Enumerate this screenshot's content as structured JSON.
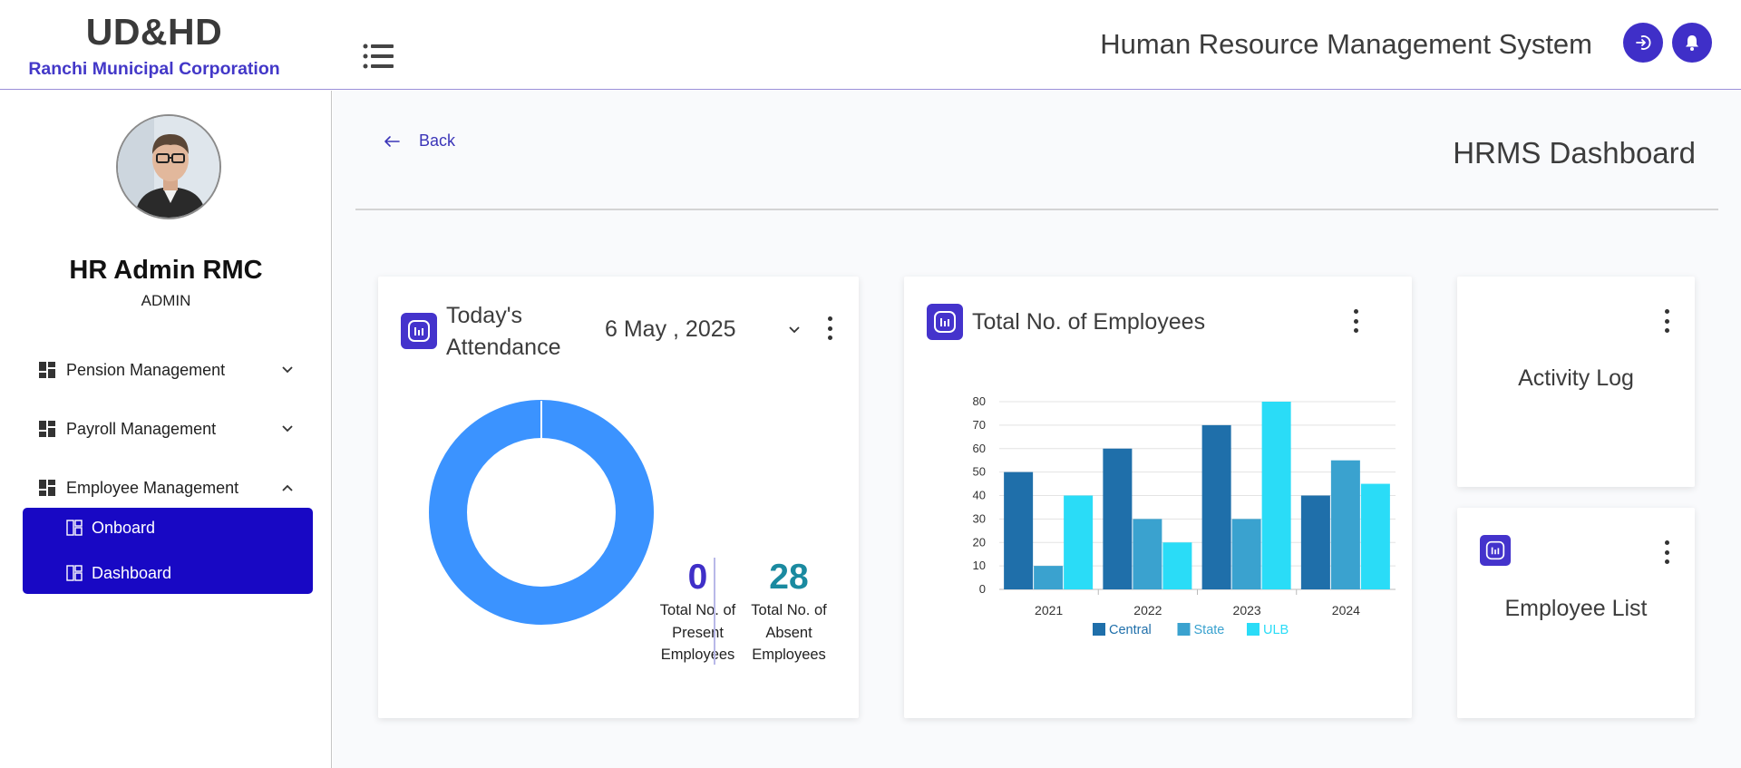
{
  "header": {
    "brand_title": "UD&HD",
    "brand_subtitle": "Ranchi Municipal Corporation",
    "app_title": "Human Resource Management System"
  },
  "sidebar": {
    "user_name": "HR Admin RMC",
    "user_role": "ADMIN",
    "items": [
      {
        "label": "Pension Management",
        "expanded": false
      },
      {
        "label": "Payroll Management",
        "expanded": false
      },
      {
        "label": "Employee Management",
        "expanded": true
      }
    ],
    "subitems": [
      {
        "label": "Onboard"
      },
      {
        "label": "Dashboard"
      }
    ]
  },
  "main": {
    "back_label": "Back",
    "page_title": "HRMS Dashboard",
    "attendance": {
      "title": "Today's Attendance",
      "date": "6 May , 2025",
      "present_count": "0",
      "present_label": "Total No. of Present Employees",
      "absent_count": "28",
      "absent_label": "Total No. of Absent Employees"
    },
    "employees": {
      "title": "Total No. of Employees"
    },
    "activity_log": {
      "title": "Activity Log"
    },
    "employee_list": {
      "title": "Employee List"
    }
  },
  "colors": {
    "accent": "#4433cc",
    "submenu_bg": "#1808c4",
    "brand_sub": "#4338c8",
    "present": "#3f2fc8",
    "absent": "#1a8aa0",
    "donut": "#3b93ff"
  },
  "chart_data": {
    "type": "bar",
    "categories": [
      "2021",
      "2022",
      "2023",
      "2024"
    ],
    "series": [
      {
        "name": "Central",
        "values": [
          50,
          60,
          70,
          40
        ],
        "color": "#1f6faa"
      },
      {
        "name": "State",
        "values": [
          10,
          30,
          30,
          55
        ],
        "color": "#3aa2cf"
      },
      {
        "name": "ULB",
        "values": [
          40,
          20,
          80,
          45
        ],
        "color": "#2adcf7"
      }
    ],
    "ylim": [
      0,
      80
    ],
    "yticks": [
      0,
      10,
      20,
      30,
      40,
      50,
      60,
      70,
      80
    ],
    "grid": true,
    "legend": "bottom"
  }
}
